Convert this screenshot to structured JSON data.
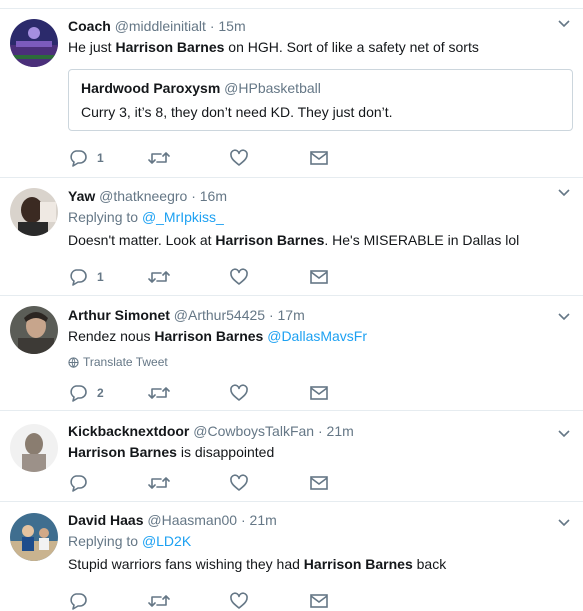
{
  "tweets": [
    {
      "fullname": "Coach",
      "username": "@middleinitialt",
      "dot": "·",
      "time": "15m",
      "text_before": "He just ",
      "bold": "Harrison Barnes",
      "text_after": " on HGH. Sort of like a safety net of sorts",
      "quote": {
        "fullname": "Hardwood Paroxysm",
        "username": "@HPbasketball",
        "text": "Curry 3, it’s 8, they don’t need KD. They just don’t."
      },
      "reply_count": "1"
    },
    {
      "fullname": "Yaw",
      "username": "@thatkneegro",
      "dot": "·",
      "time": "16m",
      "replying_label": "Replying to ",
      "replying_to": "@_MrIpkiss_",
      "text_before": "Doesn't matter. Look at ",
      "bold": "Harrison Barnes",
      "text_after": ". He's MISERABLE in Dallas lol",
      "reply_count": "1"
    },
    {
      "fullname": "Arthur Simonet",
      "username": "@Arthur54425",
      "dot": "·",
      "time": "17m",
      "text_before": "Rendez nous ",
      "bold": "Harrison Barnes",
      "text_link": " @DallasMavsFr",
      "translate": "Translate Tweet",
      "reply_count": "2"
    },
    {
      "fullname": "Kickbacknextdoor",
      "username": "@CowboysTalkFan",
      "dot": "·",
      "time": "21m",
      "bold": "Harrison Barnes",
      "text_after": " is disappointed",
      "reply_count": ""
    },
    {
      "fullname": "David Haas",
      "username": "@Haasman00",
      "dot": "·",
      "time": "21m",
      "replying_label": "Replying to ",
      "replying_to": "@LD2K",
      "text_before": "Stupid warriors fans wishing they had ",
      "bold": "Harrison Barnes",
      "text_after": " back",
      "reply_count": ""
    }
  ],
  "colors": {
    "text": "#14171a",
    "secondary": "#657786",
    "link": "#1da1f2",
    "border": "#e6ecf0"
  },
  "icons": [
    "reply-icon",
    "retweet-icon",
    "like-icon",
    "dm-icon",
    "caret-down-icon",
    "globe-icon"
  ]
}
